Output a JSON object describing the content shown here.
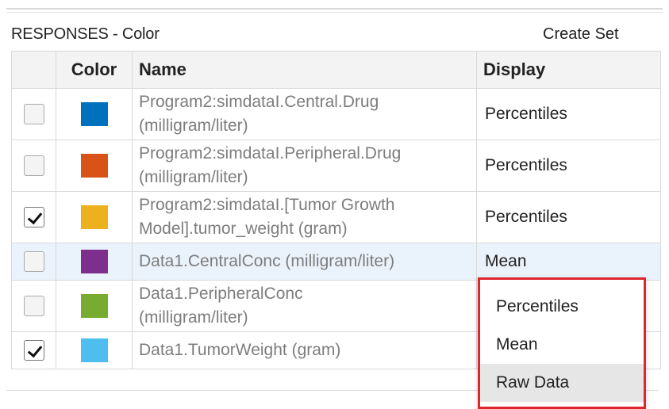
{
  "header": {
    "title": "RESPONSES -  Color",
    "create_set_label": "Create Set"
  },
  "table": {
    "columns": {
      "check": "",
      "color": "Color",
      "name": "Name",
      "display": "Display"
    },
    "rows": [
      {
        "checked": false,
        "color": "#0072BD",
        "name_line1": "Program2:simdataI.Central.Drug",
        "name_line2": "(milligram/liter)",
        "display": "Percentiles"
      },
      {
        "checked": false,
        "color": "#D95319",
        "name_line1": "Program2:simdataI.Peripheral.Drug",
        "name_line2": "(milligram/liter)",
        "display": "Percentiles"
      },
      {
        "checked": true,
        "color": "#EDB120",
        "name_line1": "Program2:simdataI.[Tumor Growth",
        "name_line2": "Model].tumor_weight (gram)",
        "display": "Percentiles"
      },
      {
        "checked": false,
        "color": "#7E2F8E",
        "name_line1": "Data1.CentralConc (milligram/liter)",
        "name_line2": "",
        "display": "Mean"
      },
      {
        "checked": false,
        "color": "#77AC30",
        "name_line1": "Data1.PeripheralConc",
        "name_line2": "(milligram/liter)",
        "display": ""
      },
      {
        "checked": true,
        "color": "#4DBEEE",
        "name_line1": "Data1.TumorWeight (gram)",
        "name_line2": "",
        "display": ""
      }
    ]
  },
  "dropdown": {
    "options": [
      "Percentiles",
      "Mean",
      "Raw Data"
    ],
    "hovered": "Raw Data",
    "highlight_color": "#e0262c"
  }
}
